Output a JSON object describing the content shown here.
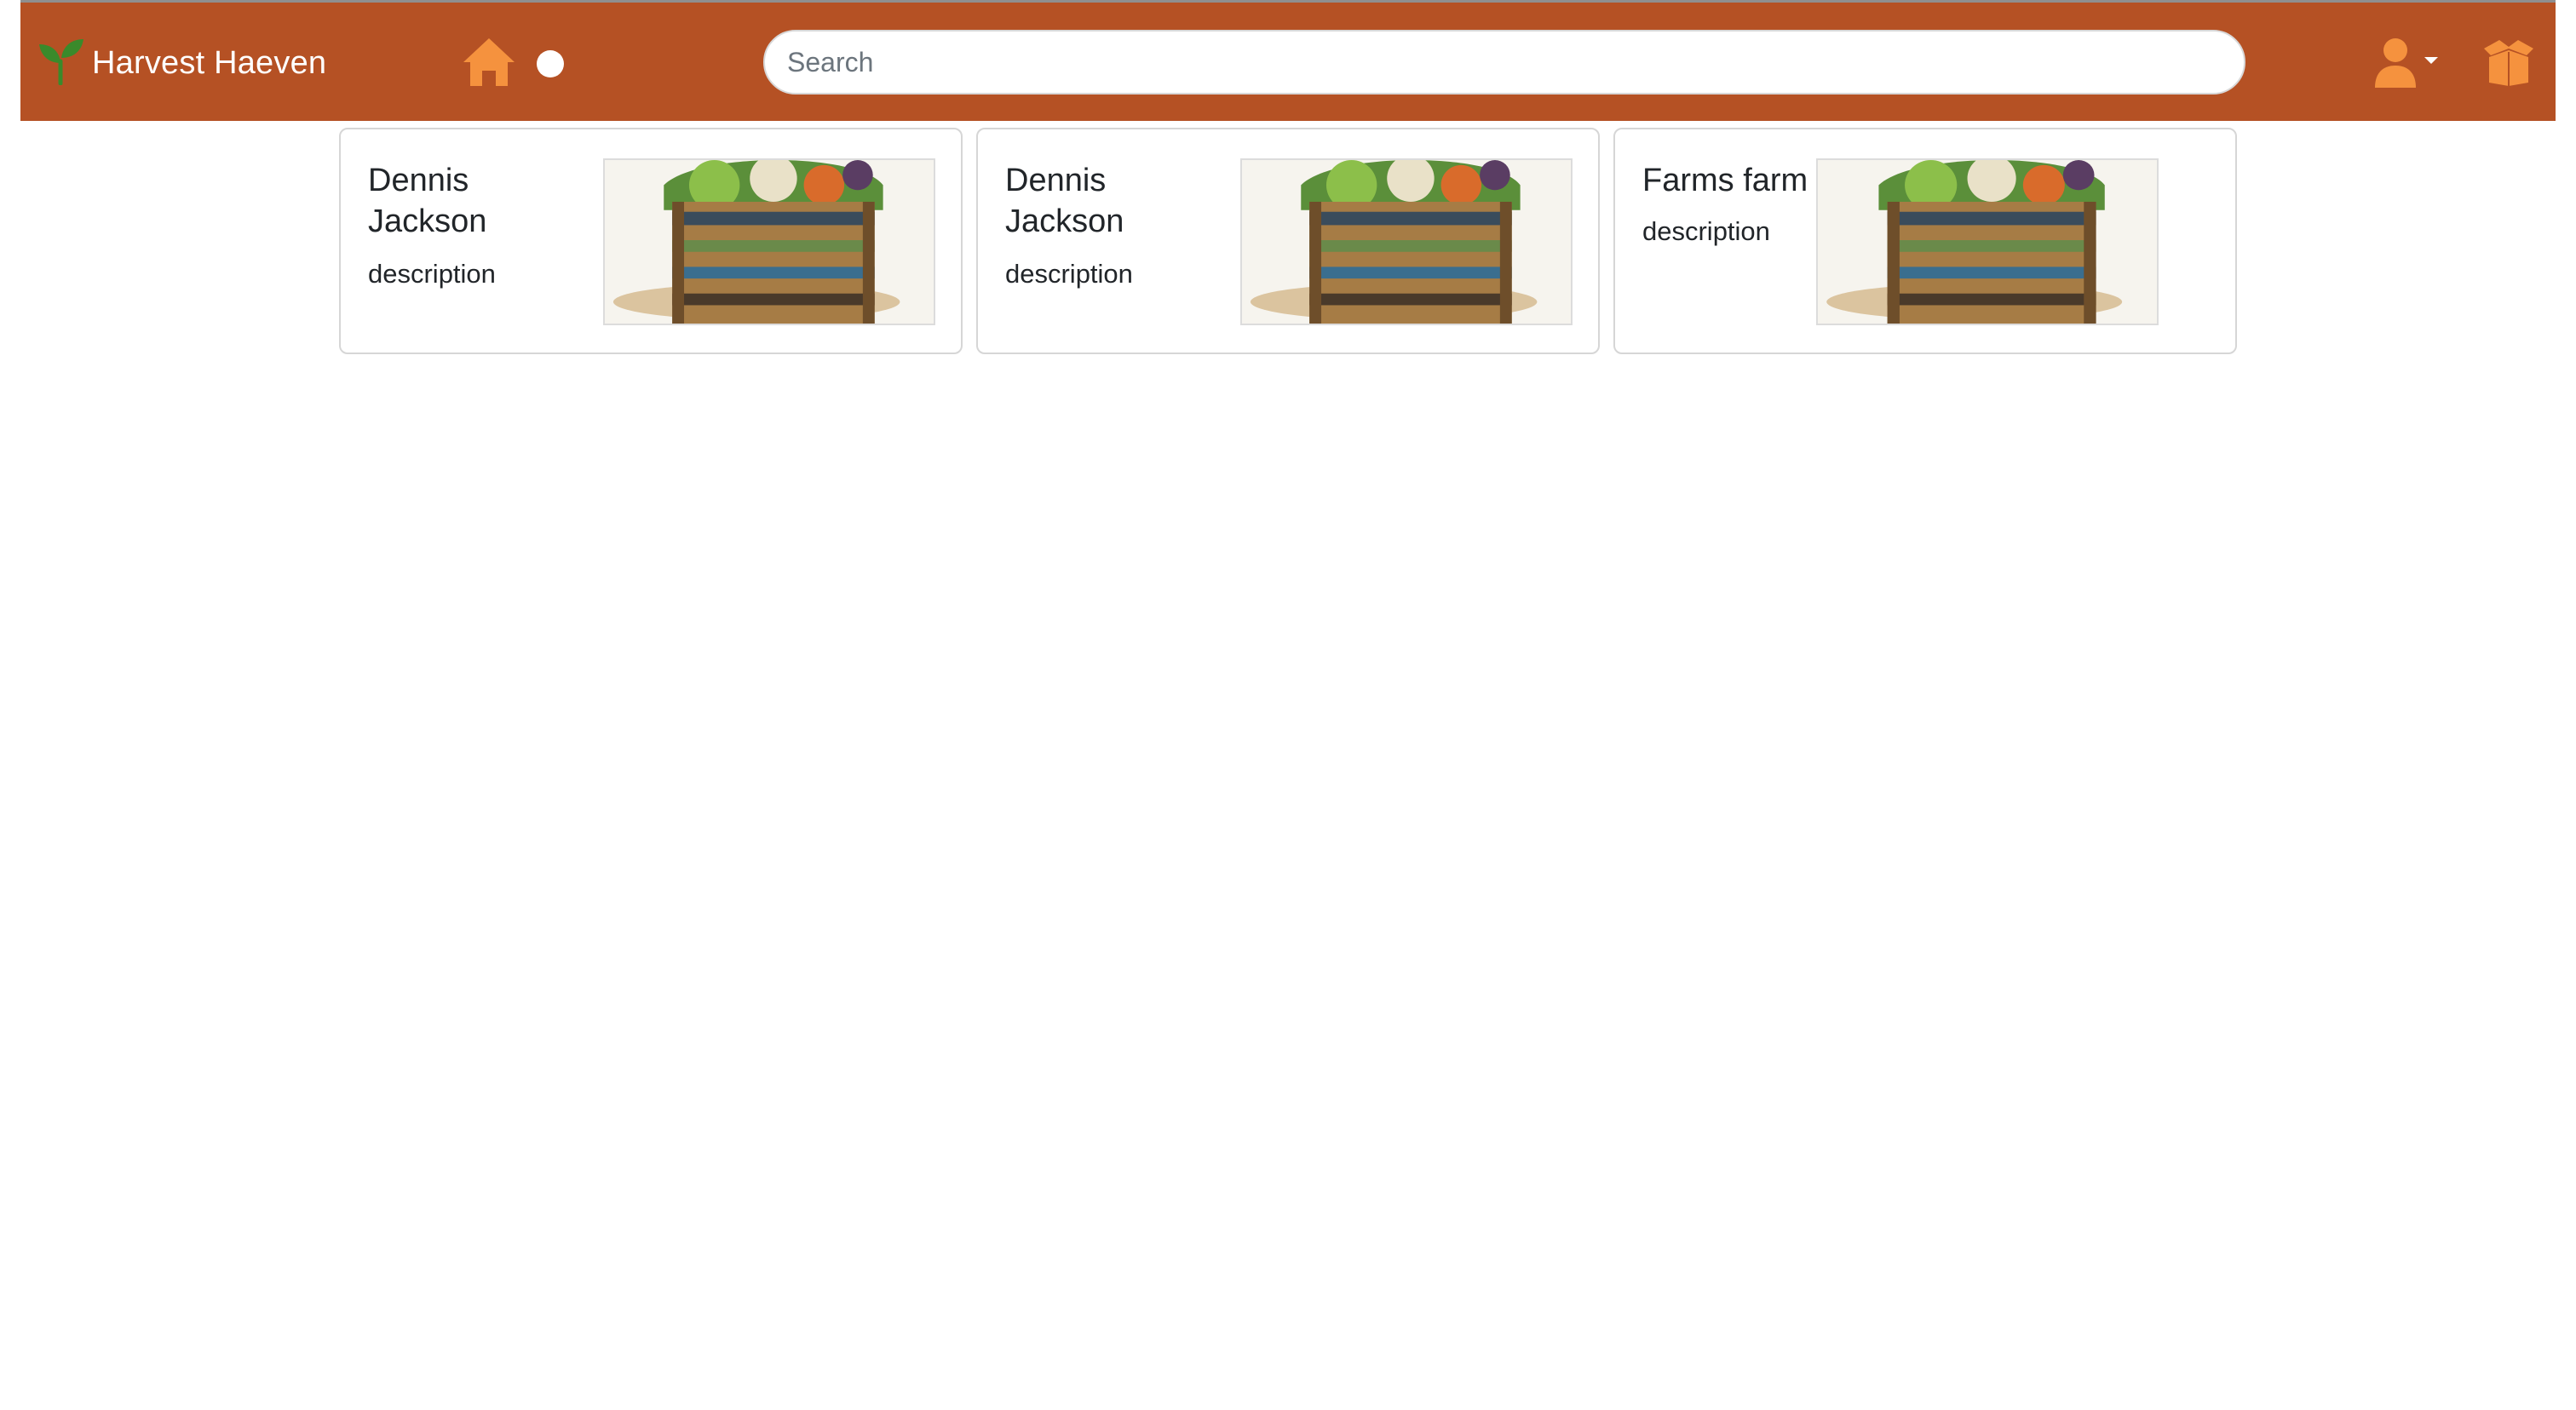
{
  "navbar": {
    "brand_name": "Harvest Haeven",
    "brand_icon": "seedling-icon",
    "home_icon": "home-icon",
    "toggle_icon": "circle-toggle-icon",
    "user_icon": "user-icon",
    "dropdown_icon": "caret-down-icon",
    "box_icon": "open-box-icon",
    "background_color": "#b55124",
    "icon_color": "#f5923e",
    "brand_icon_color": "#3a8a2b"
  },
  "search": {
    "placeholder": "Search",
    "value": ""
  },
  "cards": [
    {
      "title": "Dennis Jackson",
      "description": "description",
      "image": "vegetable-crate-image"
    },
    {
      "title": "Dennis Jackson",
      "description": "description",
      "image": "vegetable-crate-image"
    },
    {
      "title": "Farms farm",
      "description": "description",
      "image": "vegetable-crate-image"
    }
  ]
}
